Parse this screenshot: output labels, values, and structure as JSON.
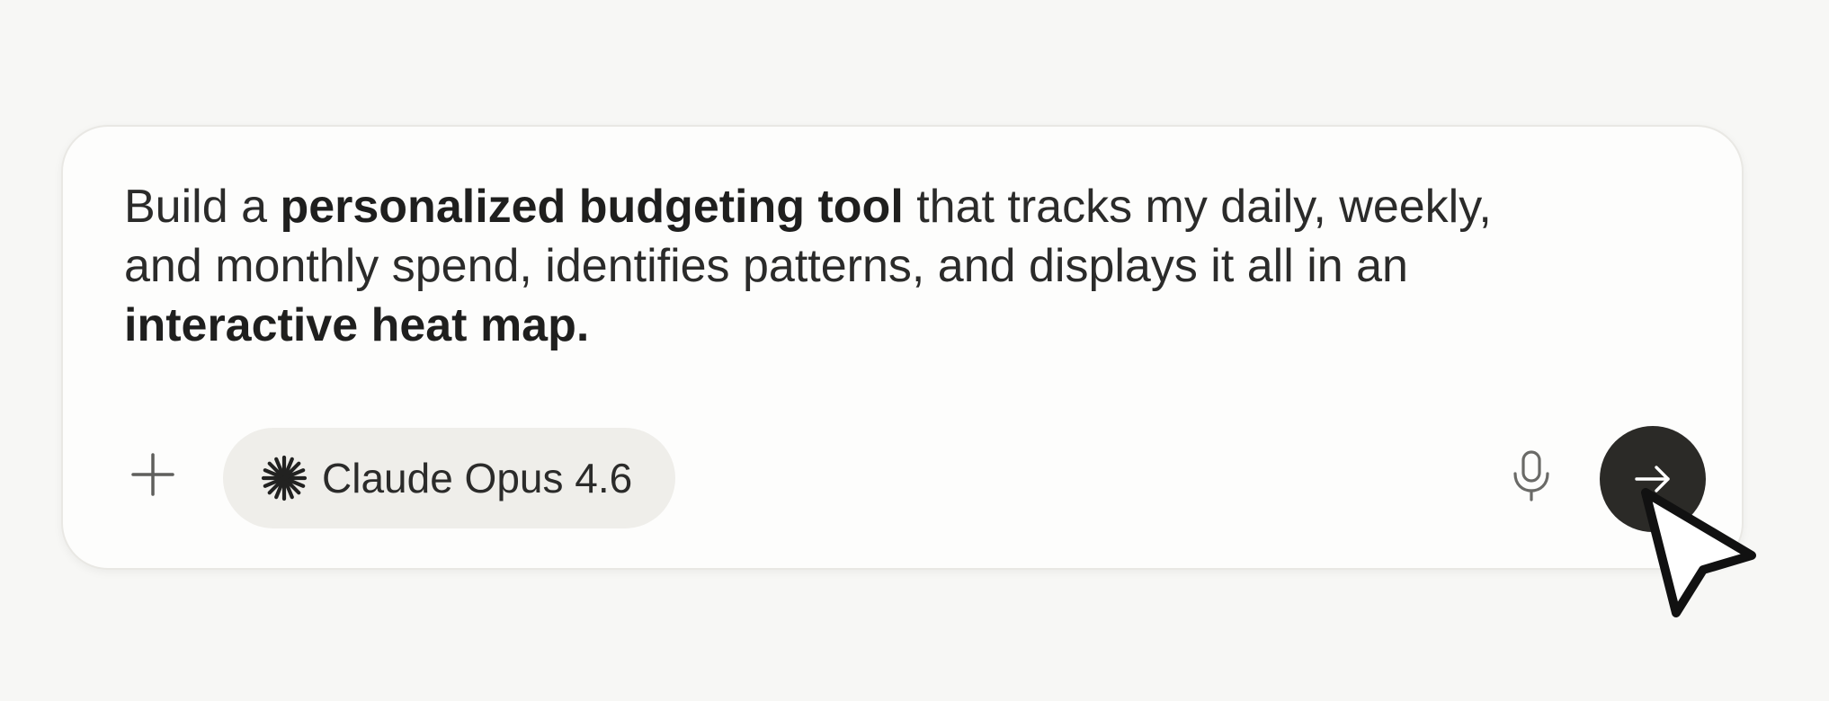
{
  "composer": {
    "prompt": {
      "part1": "Build a ",
      "bold1": "personalized budgeting tool",
      "part2": " that tracks my daily, weekly,",
      "line2": "and monthly spend, identifies patterns, and displays it all in an",
      "bold2": "interactive heat map."
    },
    "toolbar": {
      "add_icon": "plus-icon",
      "model_icon": "sparkle-icon",
      "model_label": "Claude Opus 4.6",
      "mic_icon": "microphone-icon",
      "send_icon": "arrow-right-icon"
    }
  },
  "cursor": {
    "icon": "pointer-cursor-icon"
  },
  "colors": {
    "background": "#f7f7f5",
    "composer_background": "#fdfdfc",
    "chip_background": "#efeeea",
    "send_button": "#2b2a27",
    "text": "#2b2b2a"
  }
}
